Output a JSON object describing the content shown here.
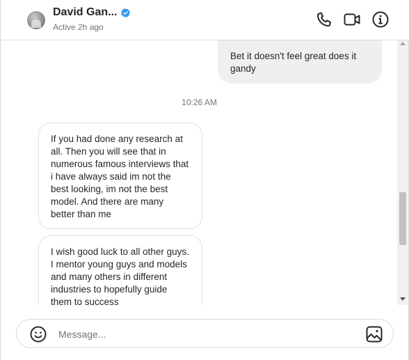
{
  "header": {
    "contact_name": "David Gan...",
    "status": "Active 2h ago",
    "icons": [
      "phone-icon",
      "video-call-icon",
      "info-icon"
    ],
    "verified_color": "#3897f0"
  },
  "thread": {
    "messages": [
      {
        "direction": "outgoing",
        "text": "Bet it doesn't feel great does it gandy"
      },
      {
        "direction": "timestamp",
        "text": "10:26 AM"
      },
      {
        "direction": "incoming",
        "text": "If you had done any research at all. Then you will see that in numerous famous interviews that i have always said im not the best looking, im not the best model. And there are many better than me"
      },
      {
        "direction": "incoming",
        "text": "I wish good luck to all other guys. I mentor young guys and models and many others in different industries to hopefully guide them to success"
      }
    ]
  },
  "composer": {
    "placeholder": "Message...",
    "icons": [
      "emoji-icon",
      "image-icon"
    ]
  }
}
